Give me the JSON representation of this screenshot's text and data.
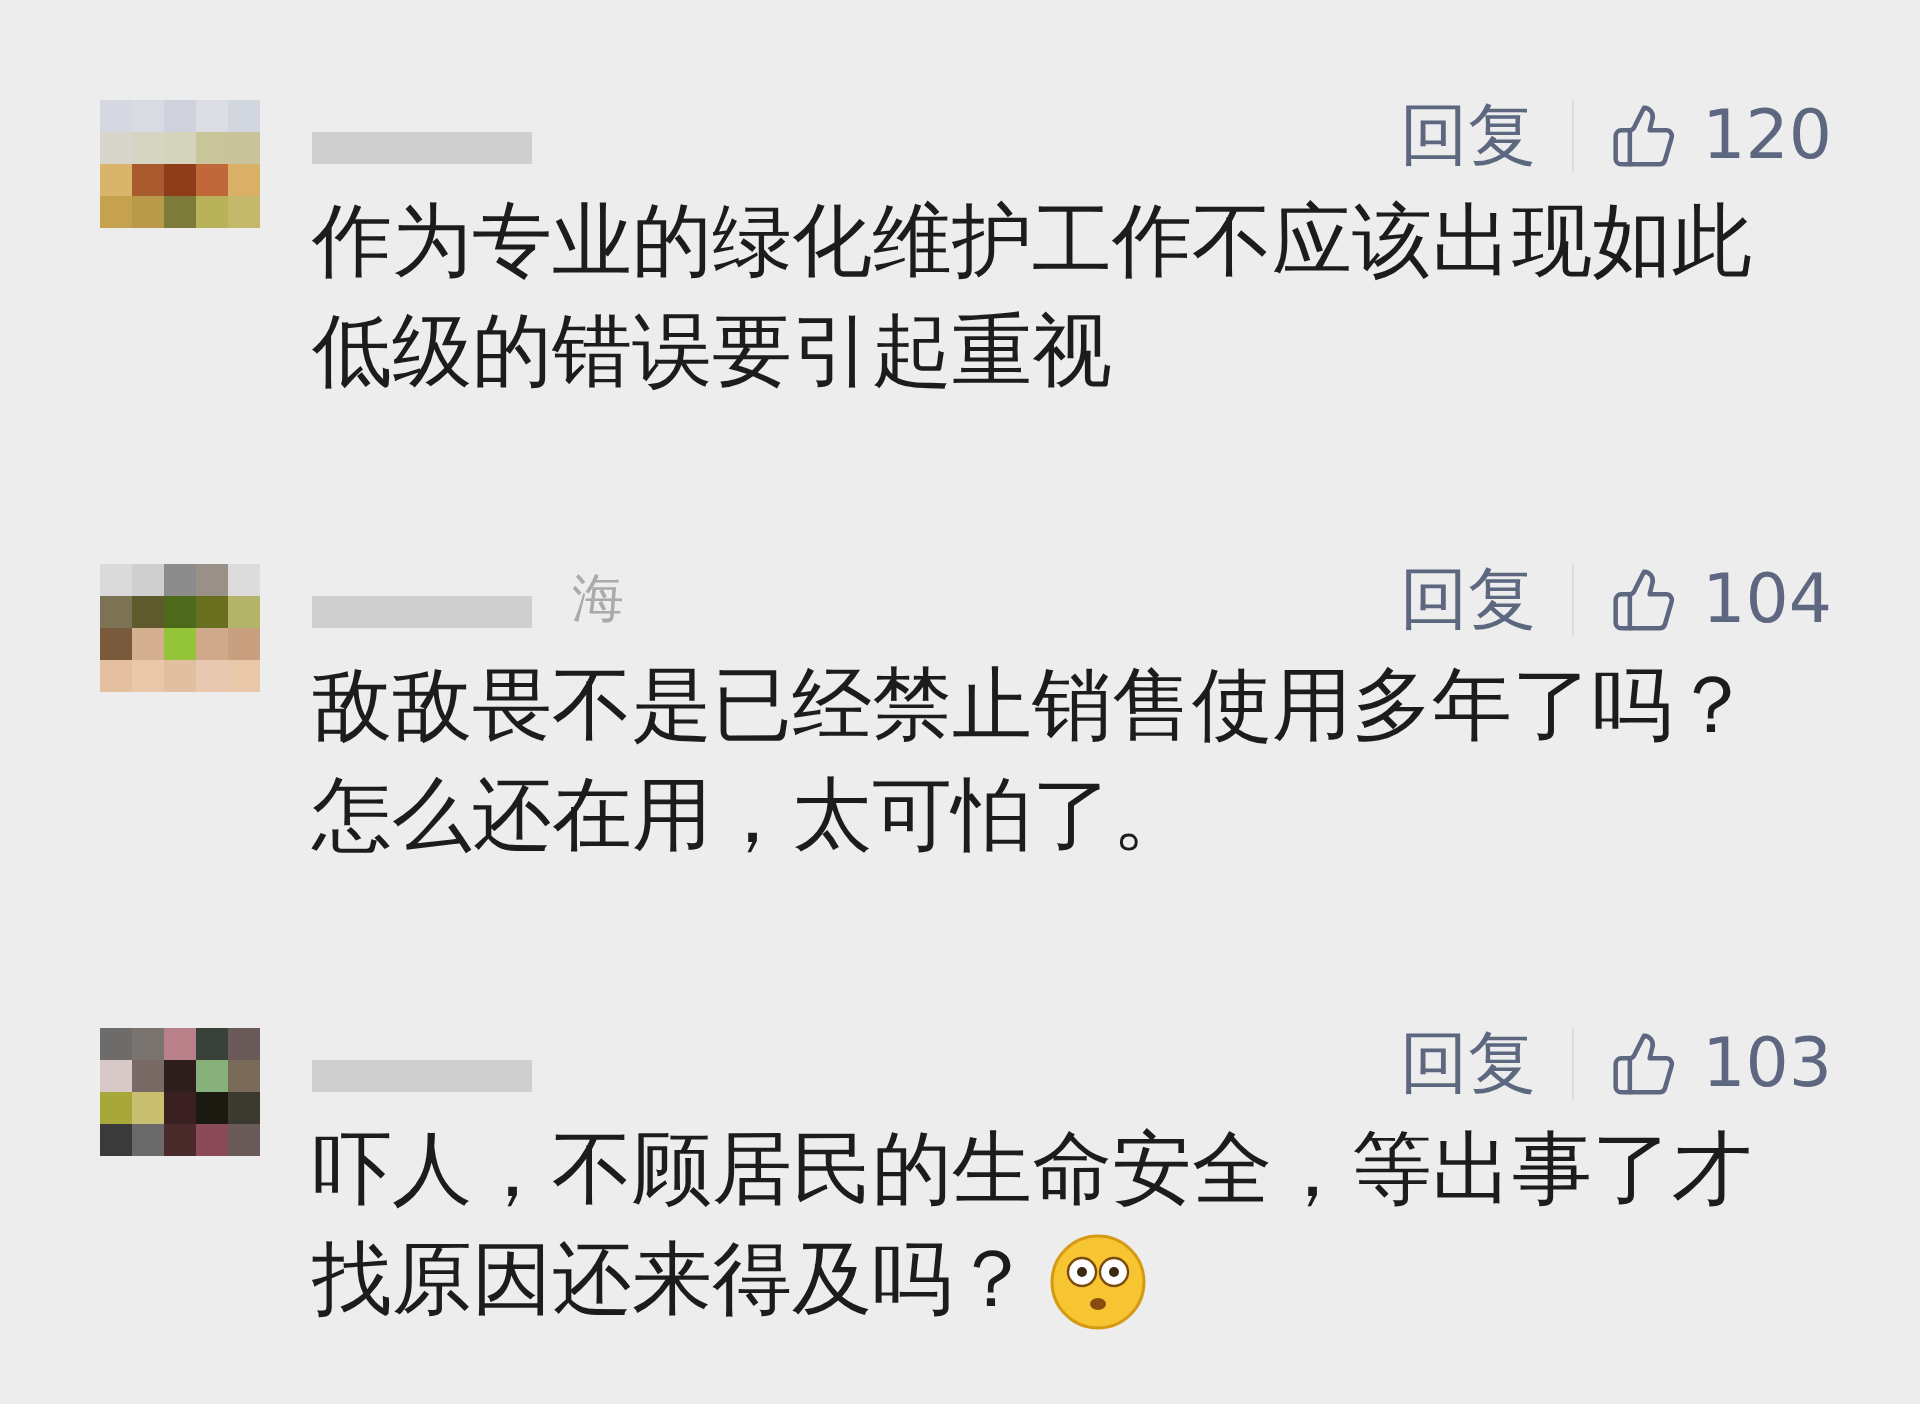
{
  "comments": [
    {
      "reply": "回复",
      "likes": "120",
      "lines": [
        "作为专业的绿化维护工作不应该出现如此",
        "低级的错误要引起重视"
      ],
      "emoji": false
    },
    {
      "name_fragment": "海",
      "reply": "回复",
      "likes": "104",
      "lines": [
        "敌敌畏不是已经禁止销售使用多年了吗？",
        "怎么还在用，太可怕了。"
      ],
      "emoji": false
    },
    {
      "reply": "回复",
      "likes": "103",
      "lines": [
        "吓人，不顾居民的生命安全，等出事了才",
        "找原因还来得及吗？"
      ],
      "emoji": true
    }
  ]
}
